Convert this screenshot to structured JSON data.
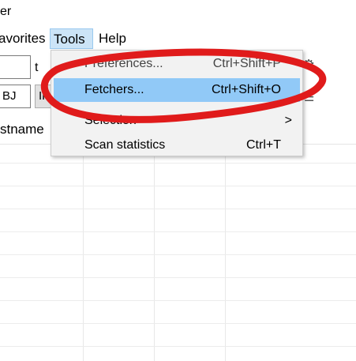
{
  "window": {
    "title_fragment": "er"
  },
  "menubar": {
    "favorites": "avorites",
    "tools": "Tools",
    "help": "Help"
  },
  "toolbar": {
    "row1_text": "t",
    "row2_input": "BJ",
    "row2_select": "IP",
    "icons": {
      "settings": "gear-icon",
      "columns": "list-icon"
    }
  },
  "table": {
    "column_header": "stname"
  },
  "tools_menu": {
    "items": [
      {
        "label": "Preferences...",
        "shortcut": "Ctrl+Shift+P"
      },
      {
        "label": "Fetchers...",
        "shortcut": "Ctrl+Shift+O",
        "highlighted": true
      },
      {
        "label": "Selection",
        "submenu_arrow": ">"
      },
      {
        "label": "Scan statistics",
        "shortcut": "Ctrl+T"
      }
    ]
  },
  "annotation": {
    "color": "#e01b1b"
  },
  "colors": {
    "menu_highlight": "#91c9f7",
    "menu_bg": "#f2f2f2",
    "tools_active": "#cce4f7"
  }
}
